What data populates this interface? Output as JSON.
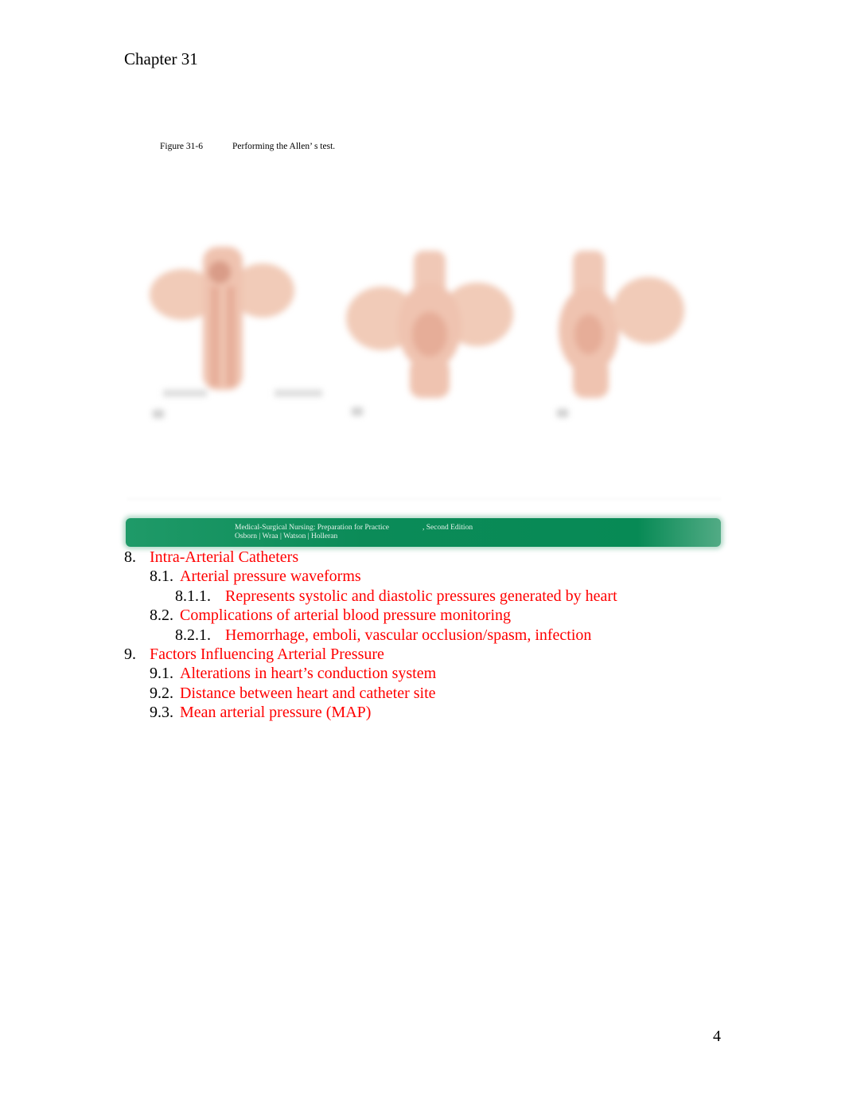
{
  "header": {
    "chapter": "Chapter 31"
  },
  "figure": {
    "number": "Figure 31-6",
    "caption": "Performing the Allen’ s test.",
    "image_description": "Three blurred illustrations of hands/wrists demonstrating the Allen's test",
    "panel_count": 3,
    "skin_color": "#efc3b0",
    "vessel_color": "#e0a08a"
  },
  "banner": {
    "book_title": "Medical-Surgical Nursing: Preparation for Practice",
    "edition": ", Second Edition",
    "authors": "Osborn | Wraa | Watson | Holleran",
    "color": "#078a55"
  },
  "outline": {
    "number_color": "#000000",
    "text_color": "#ff0000",
    "items": [
      {
        "number": "8.",
        "text": "Intra-Arterial Catheters",
        "level": 1
      },
      {
        "number": "8.1.",
        "text": "Arterial pressure waveforms",
        "level": 2
      },
      {
        "number": "8.1.1.",
        "text": "Represents systolic and diastolic pressures generated by heart",
        "level": 3
      },
      {
        "number": "8.2.",
        "text": "Complications of arterial blood pressure monitoring",
        "level": 2
      },
      {
        "number": "8.2.1.",
        "text": "Hemorrhage, emboli, vascular occlusion/spasm, infection",
        "level": 3
      },
      {
        "number": "9.",
        "text": "Factors Influencing Arterial Pressure",
        "level": 1
      },
      {
        "number": "9.1.",
        "text": "Alterations in heart’s conduction system",
        "level": 2
      },
      {
        "number": "9.2.",
        "text": "Distance between heart and catheter site",
        "level": 2
      },
      {
        "number": "9.3.",
        "text": "Mean arterial pressure (MAP)",
        "level": 2
      }
    ]
  },
  "footer": {
    "page_number": "4"
  }
}
